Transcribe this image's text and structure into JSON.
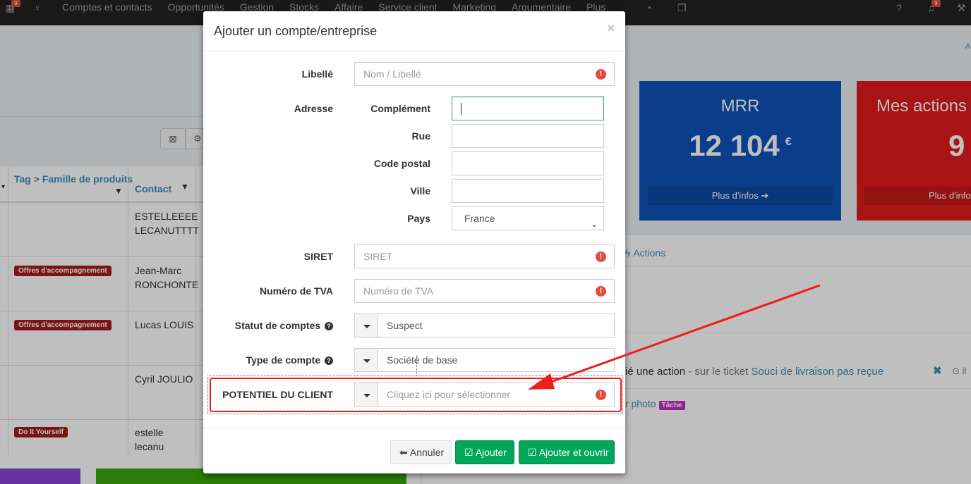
{
  "topnav": {
    "badge_calendar": "9",
    "badge_bell": "9",
    "items": [
      "Comptes et contacts",
      "Opportunités",
      "Gestion",
      "Stocks",
      "Affaire",
      "Service client",
      "Marketing",
      "Argumentaire",
      "Plus"
    ]
  },
  "table": {
    "col_tag": "Tag > Famille de produits",
    "col_contact": "Contact",
    "rows": [
      {
        "tag": "",
        "contact_1": "ESTELLEEEE",
        "contact_2": "LECANUTTTT"
      },
      {
        "tag": "Offres d'accompagnement",
        "contact_1": "Jean-Marc",
        "contact_2": "RONCHONTE"
      },
      {
        "tag": "Offres d'accompagnement",
        "contact_1": "Lucas LOUIS",
        "contact_2": ""
      },
      {
        "tag": "",
        "contact_1": "Cyril JOULIO",
        "contact_2": ""
      },
      {
        "tag": "Do It Yourself",
        "contact_1": "estelle",
        "contact_2": "lecanu"
      }
    ]
  },
  "kpis": [
    {
      "title": "MRR",
      "value": "12 104",
      "unit": "€",
      "more": "Plus d'infos"
    },
    {
      "title": "Mes actions d",
      "value": "9",
      "more": "Plus d'info"
    }
  ],
  "activity": {
    "actions_link": "Actions",
    "line_action": "ié une action",
    "line_sep": " - sur le ticket ",
    "line_ticket": "Souci de livraison pas reçue",
    "line_time": "il",
    "photo_text": "r photo",
    "photo_badge": "Tâche"
  },
  "modal": {
    "title": "Ajouter un compte/entreprise",
    "close": "×",
    "fields": {
      "libelle_label": "Libellé",
      "libelle_placeholder": "Nom / Libellé",
      "adresse_label": "Adresse",
      "complement_label": "Complément",
      "rue_label": "Rue",
      "code_postal_label": "Code postal",
      "ville_label": "Ville",
      "pays_label": "Pays",
      "pays_value": "France",
      "siret_label": "SIRET",
      "siret_placeholder": "SIRET",
      "tva_label": "Numéro de TVA",
      "tva_placeholder": "Numéro de TVA",
      "statut_label": "Statut de comptes",
      "statut_value": "Suspect",
      "type_label": "Type de compte",
      "type_value": "Société de base",
      "potentiel_label": "POTENTIEL DU CLIENT",
      "potentiel_placeholder": "Cliquez ici pour sélectionner"
    },
    "buttons": {
      "cancel": "Annuler",
      "add": "Ajouter",
      "add_open": "Ajouter et ouvrir"
    }
  },
  "colors": {
    "kpi_blue": "#0f53b9",
    "kpi_red": "#e11b1b",
    "success": "#00a65a",
    "highlight": "#e52020",
    "tag_red": "#a41b1b",
    "task_badge": "#c12fc1"
  }
}
